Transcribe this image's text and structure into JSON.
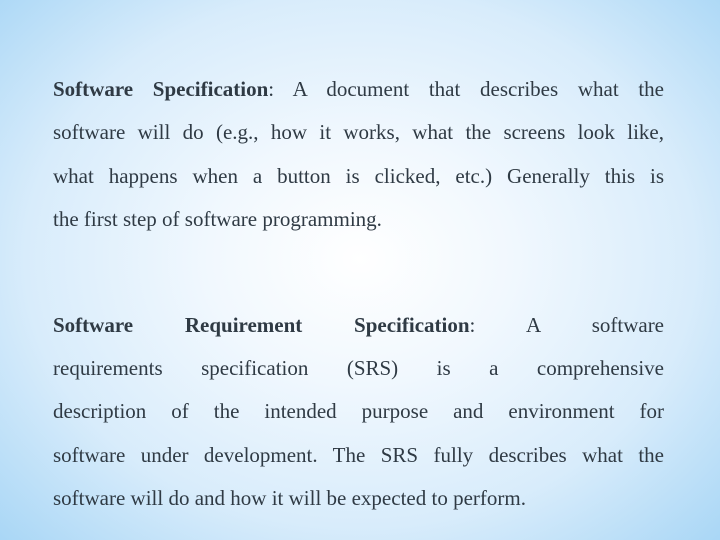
{
  "slide": {
    "paragraphs": [
      {
        "term": "Software Specification",
        "separator": ":",
        "lines": [
          " A document that describes what the",
          "software will do (e.g., how it works, what the screens look like,",
          "what happens when a button is clicked, etc.) Generally this is",
          "the first step of software programming."
        ]
      },
      {
        "term_words": [
          "Software",
          "Requirement",
          "Specification"
        ],
        "separator": ":",
        "first_line_rest": " A software",
        "lines": [
          "requirements specification (SRS) is a comprehensive",
          "description of the intended purpose and environment for",
          "software under development. The SRS fully describes what the",
          "software will do and how it will be expected to perform."
        ]
      }
    ]
  }
}
